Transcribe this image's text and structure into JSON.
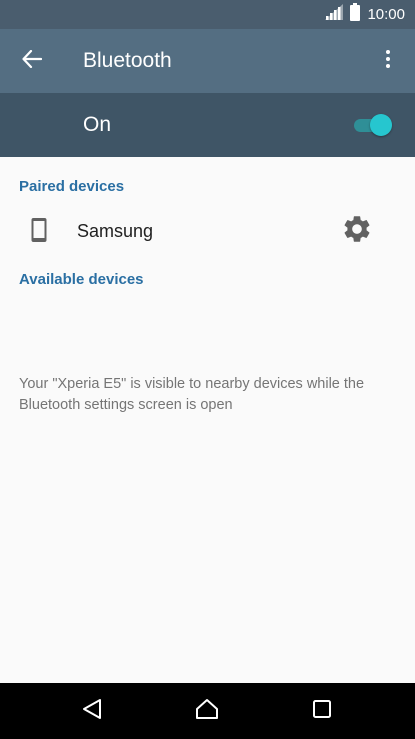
{
  "status_bar": {
    "time": "10:00",
    "signal_icon": "signal-icon",
    "battery_icon": "battery-icon"
  },
  "app_bar": {
    "title": "Bluetooth",
    "back_icon": "arrow-back-icon",
    "menu_icon": "more-vert-icon"
  },
  "master_switch": {
    "label": "On",
    "state": true,
    "accent_color": "#26c6cf"
  },
  "paired_devices": {
    "header": "Paired devices",
    "items": [
      {
        "name": "Samsung",
        "icon": "smartphone-icon",
        "action_icon": "gear-icon"
      }
    ]
  },
  "available_devices": {
    "header": "Available devices"
  },
  "visibility_note": "Your \"Xperia E5\" is visible to nearby devices while the Bluetooth settings screen is open",
  "nav_bar": {
    "back_icon": "nav-back-icon",
    "home_icon": "nav-home-icon",
    "recents_icon": "nav-recents-icon"
  },
  "colors": {
    "app_bar": "#546e82",
    "master_bar": "#3f5566",
    "status_bar": "#4a5d6e",
    "section_header": "#2a6fa3",
    "background": "#fafafa"
  }
}
